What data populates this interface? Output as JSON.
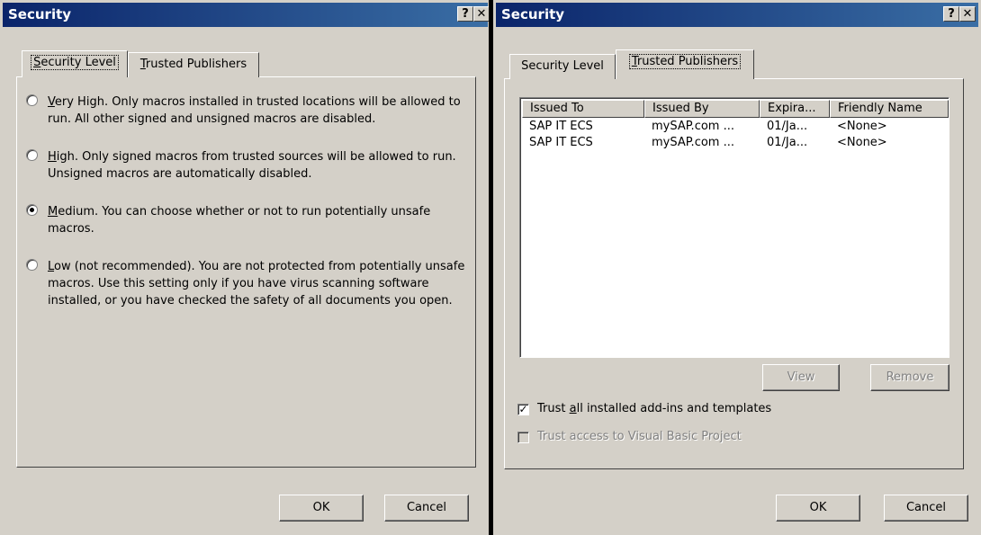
{
  "left_dialog": {
    "title": "Security",
    "help_label": "?",
    "close_label": "✕",
    "tabs": [
      {
        "label": "Security Level",
        "active": true
      },
      {
        "label": "Trusted Publishers",
        "active": false
      }
    ],
    "options": [
      {
        "accel": "V",
        "text_rest": "ery High. Only macros installed in trusted locations will be allowed to run. All other signed and unsigned macros are disabled.",
        "checked": false
      },
      {
        "accel": "H",
        "text_rest": "igh. Only signed macros from trusted sources will be allowed to run. Unsigned macros are automatically disabled.",
        "checked": false
      },
      {
        "accel": "M",
        "text_rest": "edium. You can choose whether or not to run potentially unsafe macros.",
        "checked": true
      },
      {
        "accel": "L",
        "text_rest": "ow (not recommended). You are not protected from potentially unsafe macros. Use this setting only if you have virus scanning software installed, or you have checked the safety of all documents you open.",
        "checked": false
      }
    ],
    "ok_label": "OK",
    "cancel_label": "Cancel"
  },
  "right_dialog": {
    "title": "Security",
    "help_label": "?",
    "close_label": "✕",
    "tabs": [
      {
        "label": "Security Level",
        "active": false
      },
      {
        "label": "Trusted Publishers",
        "active": true
      }
    ],
    "list": {
      "columns": [
        "Issued To",
        "Issued By",
        "Expira...",
        "Friendly Name"
      ],
      "rows": [
        [
          "SAP IT ECS",
          "mySAP.com ...",
          "01/Ja...",
          "<None>"
        ],
        [
          "SAP IT ECS",
          "mySAP.com ...",
          "01/Ja...",
          "<None>"
        ]
      ]
    },
    "view_label": "View",
    "remove_label": "Remove",
    "trust_addins": {
      "label_pre": "Trust ",
      "accel": "a",
      "label_post": "ll installed add-ins and templates",
      "checked": true
    },
    "trust_vba": {
      "label": "Trust access to Visual Basic Project",
      "checked": false,
      "disabled": true
    },
    "ok_label": "OK",
    "cancel_label": "Cancel"
  }
}
